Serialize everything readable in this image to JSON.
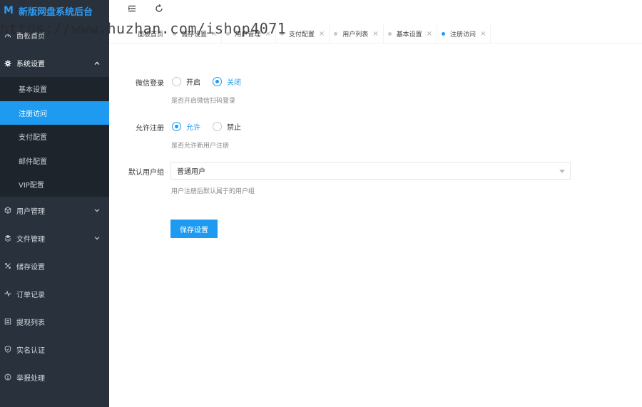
{
  "brand": {
    "logo": "M",
    "title": "新版网盘系统后台"
  },
  "watermark": "https://www.huzhan.com/ishop4071",
  "sidebar": {
    "items": [
      {
        "label": "面板首页",
        "icon": "dashboard-icon"
      },
      {
        "label": "系统设置",
        "icon": "gear-icon",
        "expanded": true,
        "children": [
          {
            "label": "基本设置"
          },
          {
            "label": "注册访问",
            "active": true
          },
          {
            "label": "支付配置"
          },
          {
            "label": "邮件配置"
          },
          {
            "label": "VIP配置"
          }
        ]
      },
      {
        "label": "用户管理",
        "icon": "users-icon",
        "chevron": "down"
      },
      {
        "label": "文件管理",
        "icon": "layers-icon",
        "chevron": "down"
      },
      {
        "label": "储存设置",
        "icon": "storage-icon"
      },
      {
        "label": "订单记录",
        "icon": "pulse-icon"
      },
      {
        "label": "提现列表",
        "icon": "list-icon"
      },
      {
        "label": "实名认证",
        "icon": "shield-icon"
      },
      {
        "label": "举报处理",
        "icon": "alert-icon"
      }
    ]
  },
  "topbar": {
    "menu_icon": "menu-toggle-icon",
    "refresh_icon": "refresh-icon"
  },
  "tabs": [
    {
      "label": "面板首页"
    },
    {
      "label": "储存设置"
    },
    {
      "label": "用户管理"
    },
    {
      "label": "支付配置"
    },
    {
      "label": "用户列表"
    },
    {
      "label": "基本设置"
    },
    {
      "label": "注册访问",
      "active": true
    }
  ],
  "tab_close": "×",
  "form": {
    "wechat_login": {
      "label": "微信登录",
      "options": [
        "开启",
        "关闭"
      ],
      "selected": "关闭",
      "hint": "是否开启微信扫码登录"
    },
    "allow_register": {
      "label": "允许注册",
      "options": [
        "允许",
        "禁止"
      ],
      "selected": "允许",
      "hint": "是否允许新用户注册"
    },
    "default_group": {
      "label": "默认用户组",
      "value": "普通用户",
      "hint": "用户注册后默认属于的用户组"
    },
    "save_label": "保存设置"
  },
  "colors": {
    "accent": "#1e9bf0",
    "sidebar_bg": "#28313c",
    "submenu_bg": "#1d242c"
  }
}
